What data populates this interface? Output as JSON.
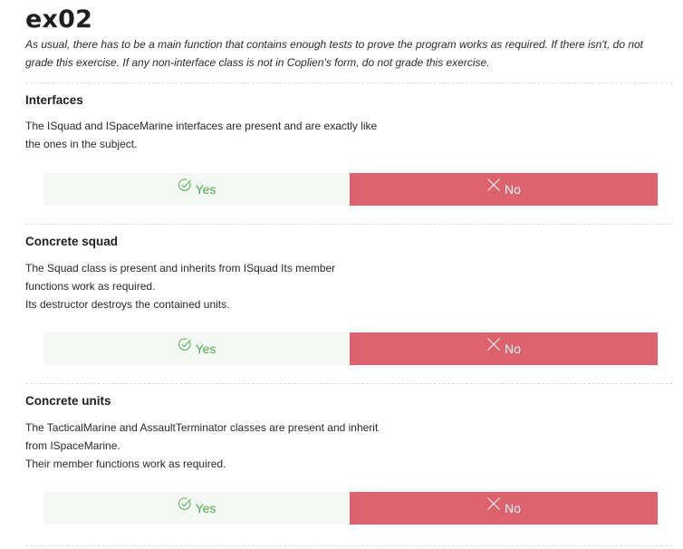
{
  "exercise": {
    "title": "ex02",
    "intro": "As usual, there has to be a main function that contains enough tests to prove the program works as required. If there isn't, do not grade this exercise. If any non-interface class is not in Coplien's form, do not grade this exercise."
  },
  "sections": [
    {
      "heading": "Interfaces",
      "lines": [
        "The ISquad and ISpaceMarine interfaces are present and are exactly like",
        "the ones in the subject."
      ],
      "yes_label": "Yes",
      "no_label": "No"
    },
    {
      "heading": "Concrete squad",
      "lines": [
        "The Squad class is present and inherits from ISquad Its member",
        "functions work as required.",
        "Its destructor destroys the contained units."
      ],
      "yes_label": "Yes",
      "no_label": "No"
    },
    {
      "heading": "Concrete units",
      "lines": [
        "The TacticalMarine and AssaultTerminator classes are present and inherit",
        "from ISpaceMarine.",
        "Their member functions work as required."
      ],
      "yes_label": "Yes",
      "no_label": "No"
    }
  ],
  "colors": {
    "yes_bg": "#f3f8f3",
    "yes_text": "#4cae4c",
    "no_bg": "#dc626d",
    "no_text": "#ffffff"
  },
  "icons": {
    "yes": "check-circle-icon",
    "no": "x-mark-icon"
  }
}
